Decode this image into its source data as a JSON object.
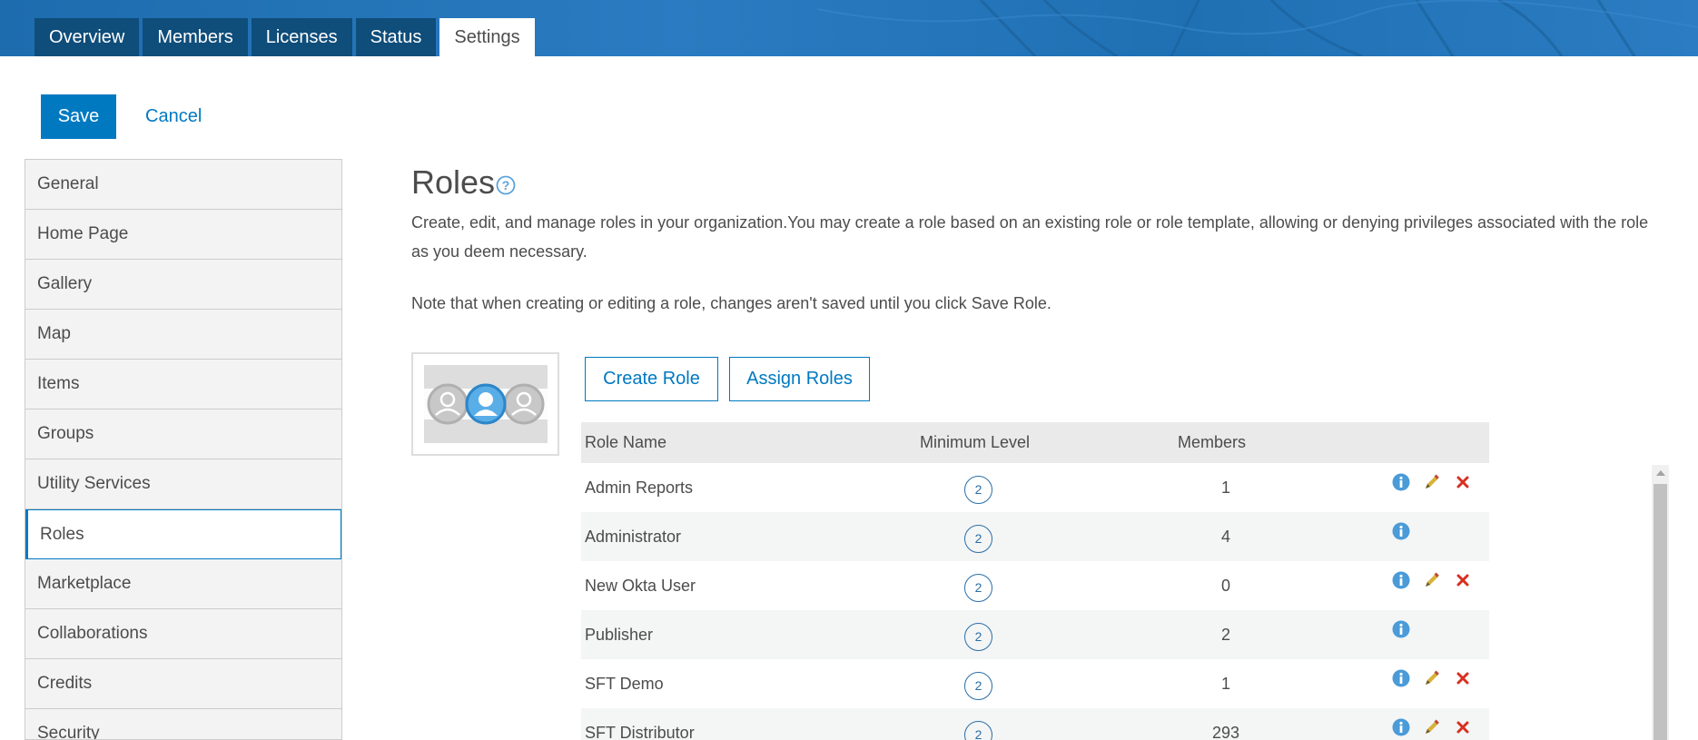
{
  "tabs": [
    {
      "label": "Overview",
      "active": false
    },
    {
      "label": "Members",
      "active": false
    },
    {
      "label": "Licenses",
      "active": false
    },
    {
      "label": "Status",
      "active": false
    },
    {
      "label": "Settings",
      "active": true
    }
  ],
  "actions": {
    "save_label": "Save",
    "cancel_label": "Cancel"
  },
  "sidebar": {
    "items": [
      {
        "label": "General",
        "active": false
      },
      {
        "label": "Home Page",
        "active": false
      },
      {
        "label": "Gallery",
        "active": false
      },
      {
        "label": "Map",
        "active": false
      },
      {
        "label": "Items",
        "active": false
      },
      {
        "label": "Groups",
        "active": false
      },
      {
        "label": "Utility Services",
        "active": false
      },
      {
        "label": "Roles",
        "active": true
      },
      {
        "label": "Marketplace",
        "active": false
      },
      {
        "label": "Collaborations",
        "active": false
      },
      {
        "label": "Credits",
        "active": false
      },
      {
        "label": "Security",
        "active": false
      }
    ]
  },
  "main": {
    "title": "Roles",
    "description": "Create, edit, and manage roles in your organization.You may create a role based on an existing role or role template, allowing or denying privileges associated with the role as you deem necessary.",
    "note": "Note that when creating or editing a role, changes aren't saved until you click Save Role.",
    "create_role_label": "Create Role",
    "assign_roles_label": "Assign Roles"
  },
  "table": {
    "headers": {
      "name": "Role Name",
      "level": "Minimum Level",
      "members": "Members"
    },
    "rows": [
      {
        "name": "Admin Reports",
        "level": "2",
        "members": "1",
        "editable": true
      },
      {
        "name": "Administrator",
        "level": "2",
        "members": "4",
        "editable": false
      },
      {
        "name": "New Okta User",
        "level": "2",
        "members": "0",
        "editable": true
      },
      {
        "name": "Publisher",
        "level": "2",
        "members": "2",
        "editable": false
      },
      {
        "name": "SFT Demo",
        "level": "2",
        "members": "1",
        "editable": true
      },
      {
        "name": "SFT Distributor",
        "level": "2",
        "members": "293",
        "editable": true
      }
    ]
  },
  "colors": {
    "accent": "#0079c1",
    "banner": "#1f70b3",
    "tab_dark": "#0f4d7a",
    "delete": "#d83020",
    "edit": "#c9a227"
  },
  "icons": {
    "help": "help-circle-icon",
    "info": "info-icon",
    "edit": "pencil-icon",
    "delete": "close-icon"
  }
}
